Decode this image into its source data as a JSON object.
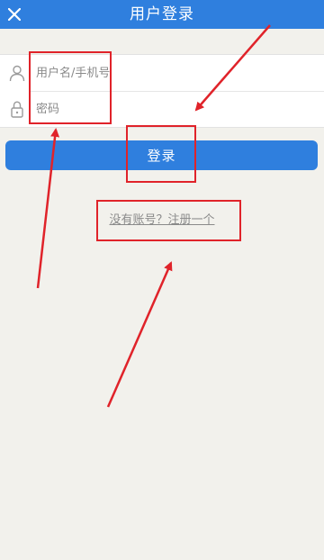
{
  "header": {
    "title": "用户登录",
    "close_icon": "close-icon"
  },
  "form": {
    "username_placeholder": "用户名/手机号",
    "password_placeholder": "密码",
    "username_icon": "user-icon",
    "password_icon": "lock-icon"
  },
  "actions": {
    "login_label": "登录",
    "register_link": "没有账号？注册一个"
  },
  "colors": {
    "primary": "#2f7fde",
    "background": "#f2f1ec",
    "annotation": "#e0232a"
  }
}
